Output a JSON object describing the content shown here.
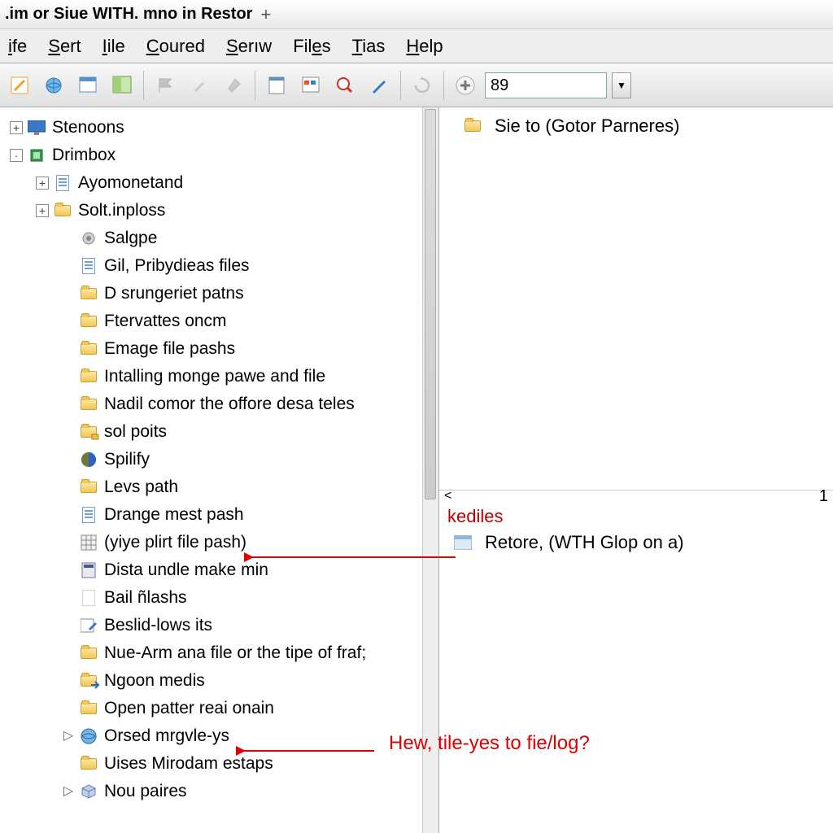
{
  "title": ".im or Siue WITH. mno in Restor",
  "menu": [
    "ife",
    "Sert",
    "Iile",
    "Coured",
    "Serıw",
    "Files",
    "Tias",
    "Help"
  ],
  "menu_ul": [
    0,
    0,
    0,
    0,
    0,
    3,
    0,
    0
  ],
  "toolbar": {
    "input_value": "89"
  },
  "tree": [
    {
      "d": 0,
      "exp": "+",
      "ic": "screen",
      "t": "Stenoons"
    },
    {
      "d": 0,
      "exp": "-",
      "ic": "chip",
      "t": "Drimbox"
    },
    {
      "d": 1,
      "exp": "+",
      "ic": "doc",
      "t": "Ayomonetand"
    },
    {
      "d": 1,
      "exp": "+",
      "ic": "fold",
      "t": "Solt.inploss"
    },
    {
      "d": 2,
      "ic": "gear",
      "t": "Salgpe"
    },
    {
      "d": 2,
      "ic": "doc",
      "t": "Gil, Pribydieas files"
    },
    {
      "d": 2,
      "ic": "fold",
      "t": "D srungeriet patns"
    },
    {
      "d": 2,
      "ic": "fold",
      "t": "Ftervattes oncm"
    },
    {
      "d": 2,
      "ic": "fold",
      "t": "Emage file pashs"
    },
    {
      "d": 2,
      "ic": "fold",
      "t": "Intalling monge pawe and file"
    },
    {
      "d": 2,
      "ic": "fold",
      "t": "Nadil comor the offore desa teles"
    },
    {
      "d": 2,
      "ic": "foldlock",
      "t": "sol poits"
    },
    {
      "d": 2,
      "ic": "globe",
      "t": "Spilify"
    },
    {
      "d": 2,
      "ic": "fold",
      "t": "Levs path"
    },
    {
      "d": 2,
      "ic": "doc",
      "t": "Drange mest pash"
    },
    {
      "d": 2,
      "ic": "grid",
      "t": "(yiye plirt file pash)"
    },
    {
      "d": 2,
      "ic": "calc",
      "t": "Dista undle make min"
    },
    {
      "d": 2,
      "ic": "page",
      "t": "Bail ñlashs"
    },
    {
      "d": 2,
      "ic": "pencil",
      "t": "Beslid-lows its"
    },
    {
      "d": 2,
      "ic": "fold",
      "t": "Nue-Arm ana file or the tipe of fraf;"
    },
    {
      "d": 2,
      "ic": "foldarrow",
      "t": "Ngoon medis"
    },
    {
      "d": 2,
      "ic": "fold",
      "t": "Open patter reai onain"
    },
    {
      "d": 2,
      "exp": "tri",
      "ic": "globe2",
      "t": "Orsed mrgvle-ys"
    },
    {
      "d": 2,
      "ic": "fold",
      "t": "Uises Mirodam estaps"
    },
    {
      "d": 2,
      "exp": "tri",
      "ic": "cube",
      "t": "Nou paires"
    }
  ],
  "right": {
    "top_item": "Sie to (Gotor Parneres)",
    "sep_num": "1",
    "header": "kediles",
    "item": "Retore, (WTH Glop on a)"
  },
  "anno1": "Hew, tile-yes to fie/log?"
}
